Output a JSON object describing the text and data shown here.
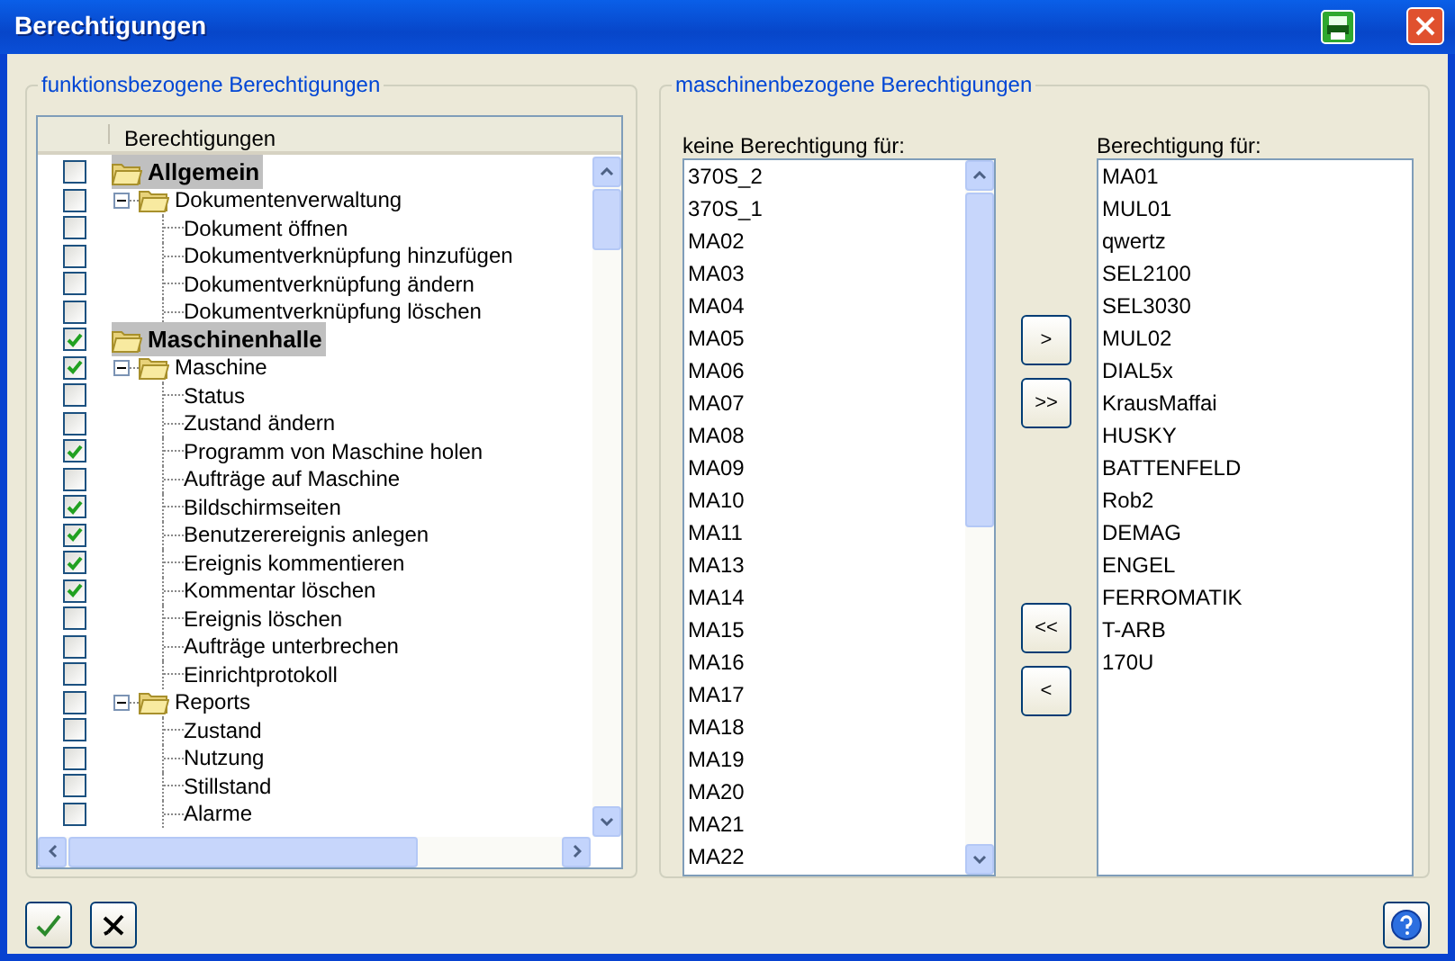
{
  "window": {
    "title": "Berechtigungen"
  },
  "function_permissions": {
    "legend": "funktionsbezogene Berechtigungen",
    "column_header": "Berechtigungen",
    "items": [
      {
        "label": "Allgemein",
        "kind": "category",
        "checked": false,
        "children": [
          {
            "label": "Dokumentenverwaltung",
            "kind": "folder",
            "checked": false,
            "expanded": true,
            "children": [
              {
                "label": "Dokument öffnen",
                "kind": "leaf",
                "checked": false
              },
              {
                "label": "Dokumentverknüpfung hinzufügen",
                "kind": "leaf",
                "checked": false
              },
              {
                "label": "Dokumentverknüpfung ändern",
                "kind": "leaf",
                "checked": false
              },
              {
                "label": "Dokumentverknüpfung löschen",
                "kind": "leaf",
                "checked": false
              }
            ]
          }
        ]
      },
      {
        "label": "Maschinenhalle",
        "kind": "category",
        "checked": true,
        "children": [
          {
            "label": "Maschine",
            "kind": "folder",
            "checked": true,
            "expanded": true,
            "children": [
              {
                "label": "Status",
                "kind": "leaf",
                "checked": false
              },
              {
                "label": "Zustand ändern",
                "kind": "leaf",
                "checked": false
              },
              {
                "label": "Programm von Maschine holen",
                "kind": "leaf",
                "checked": true
              },
              {
                "label": "Aufträge auf Maschine",
                "kind": "leaf",
                "checked": false
              },
              {
                "label": "Bildschirmseiten",
                "kind": "leaf",
                "checked": true
              },
              {
                "label": "Benutzerereignis anlegen",
                "kind": "leaf",
                "checked": true
              },
              {
                "label": "Ereignis kommentieren",
                "kind": "leaf",
                "checked": true
              },
              {
                "label": "Kommentar löschen",
                "kind": "leaf",
                "checked": true
              },
              {
                "label": "Ereignis löschen",
                "kind": "leaf",
                "checked": false
              },
              {
                "label": "Aufträge unterbrechen",
                "kind": "leaf",
                "checked": false
              },
              {
                "label": "Einrichtprotokoll",
                "kind": "leaf",
                "checked": false
              }
            ]
          },
          {
            "label": "Reports",
            "kind": "folder",
            "checked": false,
            "expanded": true,
            "children": [
              {
                "label": "Zustand",
                "kind": "leaf",
                "checked": false
              },
              {
                "label": "Nutzung",
                "kind": "leaf",
                "checked": false
              },
              {
                "label": "Stillstand",
                "kind": "leaf",
                "checked": false
              },
              {
                "label": "Alarme",
                "kind": "leaf",
                "checked": false
              }
            ]
          }
        ]
      }
    ]
  },
  "machine_permissions": {
    "legend": "maschinenbezogene Berechtigungen",
    "available": {
      "label": "keine Berechtigung für:",
      "items": [
        "370S_2",
        "370S_1",
        "MA02",
        "MA03",
        "MA04",
        "MA05",
        "MA06",
        "MA07",
        "MA08",
        "MA09",
        "MA10",
        "MA11",
        "MA13",
        "MA14",
        "MA15",
        "MA16",
        "MA17",
        "MA18",
        "MA19",
        "MA20",
        "MA21",
        "MA22"
      ]
    },
    "granted": {
      "label": "Berechtigung für:",
      "items": [
        "MA01",
        "MUL01",
        "qwertz",
        "SEL2100",
        "SEL3030",
        "MUL02",
        "DIAL5x",
        "KrausMaffai",
        "HUSKY",
        "BATTENFELD",
        "Rob2",
        "DEMAG",
        "ENGEL",
        "FERROMATIK",
        "T-ARB",
        "170U"
      ]
    },
    "move_buttons": [
      ">",
      ">>",
      "<<",
      "<"
    ]
  }
}
